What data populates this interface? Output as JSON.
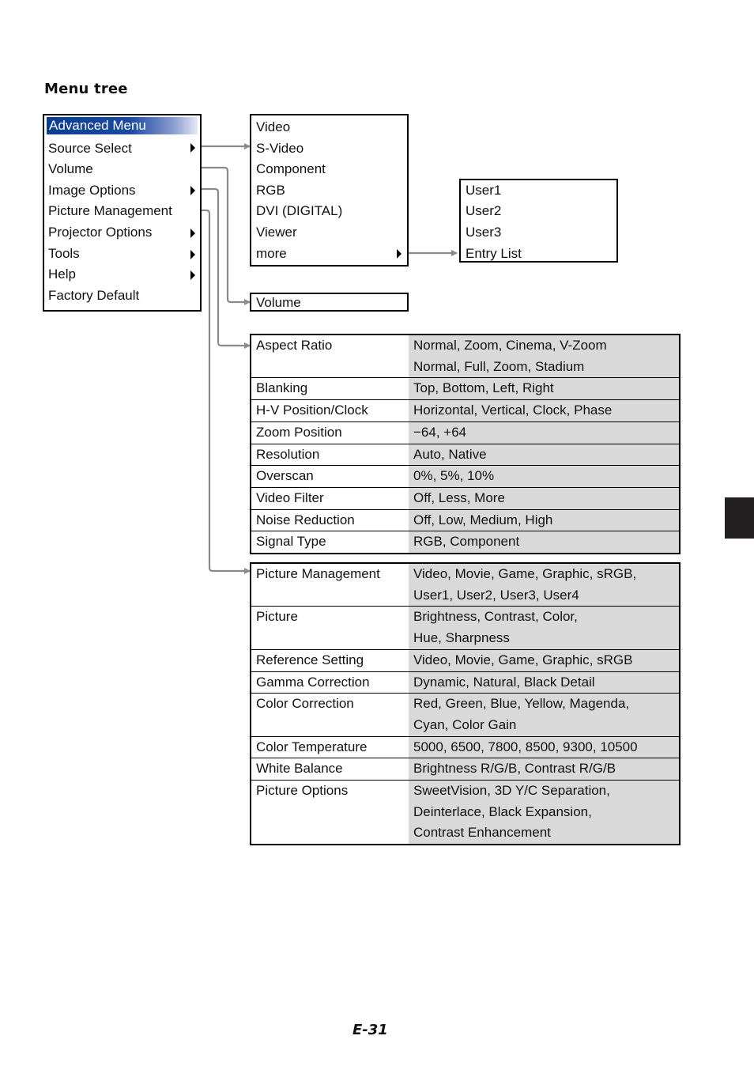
{
  "page": {
    "section_title": "Menu tree",
    "page_number": "E-31",
    "colors": {
      "header_highlight": "#0a3d93",
      "connector": "#8a8a8a",
      "value_column_bg": "#d9d9d9",
      "side_tab": "#231f20"
    }
  },
  "advanced_menu": {
    "header": "Advanced Menu",
    "items": [
      {
        "label": "Source Select",
        "has_submenu": true
      },
      {
        "label": "Volume",
        "has_submenu": false
      },
      {
        "label": "Image Options",
        "has_submenu": true
      },
      {
        "label": "Picture Management",
        "has_submenu": false
      },
      {
        "label": "Projector Options",
        "has_submenu": true
      },
      {
        "label": "Tools",
        "has_submenu": true
      },
      {
        "label": "Help",
        "has_submenu": true
      },
      {
        "label": "Factory Default",
        "has_submenu": false
      }
    ]
  },
  "source_select_menu": {
    "items": [
      "Video",
      "S-Video",
      "Component",
      "RGB",
      "DVI (DIGITAL)",
      "Viewer",
      "more"
    ]
  },
  "more_menu": {
    "items": [
      "User1",
      "User2",
      "User3",
      "Entry List"
    ]
  },
  "volume_menu": {
    "label": "Volume"
  },
  "image_options_table": {
    "rows": [
      {
        "setting": "Aspect Ratio",
        "options": "Normal, Zoom, Cinema, V-Zoom\nNormal, Full, Zoom, Stadium"
      },
      {
        "setting": "Blanking",
        "options": "Top, Bottom, Left, Right"
      },
      {
        "setting": "H-V Position/Clock",
        "options": "Horizontal, Vertical, Clock, Phase"
      },
      {
        "setting": "Zoom Position",
        "options": "−64, +64"
      },
      {
        "setting": "Resolution",
        "options": "Auto, Native"
      },
      {
        "setting": "Overscan",
        "options": "0%, 5%, 10%"
      },
      {
        "setting": "Video Filter",
        "options": "Off, Less, More"
      },
      {
        "setting": "Noise Reduction",
        "options": "Off, Low, Medium, High"
      },
      {
        "setting": "Signal Type",
        "options": "RGB, Component"
      }
    ]
  },
  "picture_management_table": {
    "rows": [
      {
        "setting": "Picture Management",
        "options": "Video, Movie, Game, Graphic, sRGB,\nUser1, User2, User3, User4"
      },
      {
        "setting": "Picture",
        "options": "Brightness, Contrast, Color,\nHue, Sharpness"
      },
      {
        "setting": "Reference Setting",
        "options": "Video, Movie, Game, Graphic, sRGB"
      },
      {
        "setting": "Gamma Correction",
        "options": "Dynamic, Natural, Black Detail"
      },
      {
        "setting": "Color Correction",
        "options": "Red, Green, Blue, Yellow, Magenda,\nCyan, Color Gain"
      },
      {
        "setting": "Color Temperature",
        "options": "5000, 6500, 7800, 8500, 9300, 10500"
      },
      {
        "setting": "White Balance",
        "options": "Brightness R/G/B, Contrast R/G/B"
      },
      {
        "setting": "Picture Options",
        "options": "SweetVision, 3D Y/C Separation,\nDeinterlace, Black Expansion,\nContrast Enhancement"
      }
    ]
  }
}
